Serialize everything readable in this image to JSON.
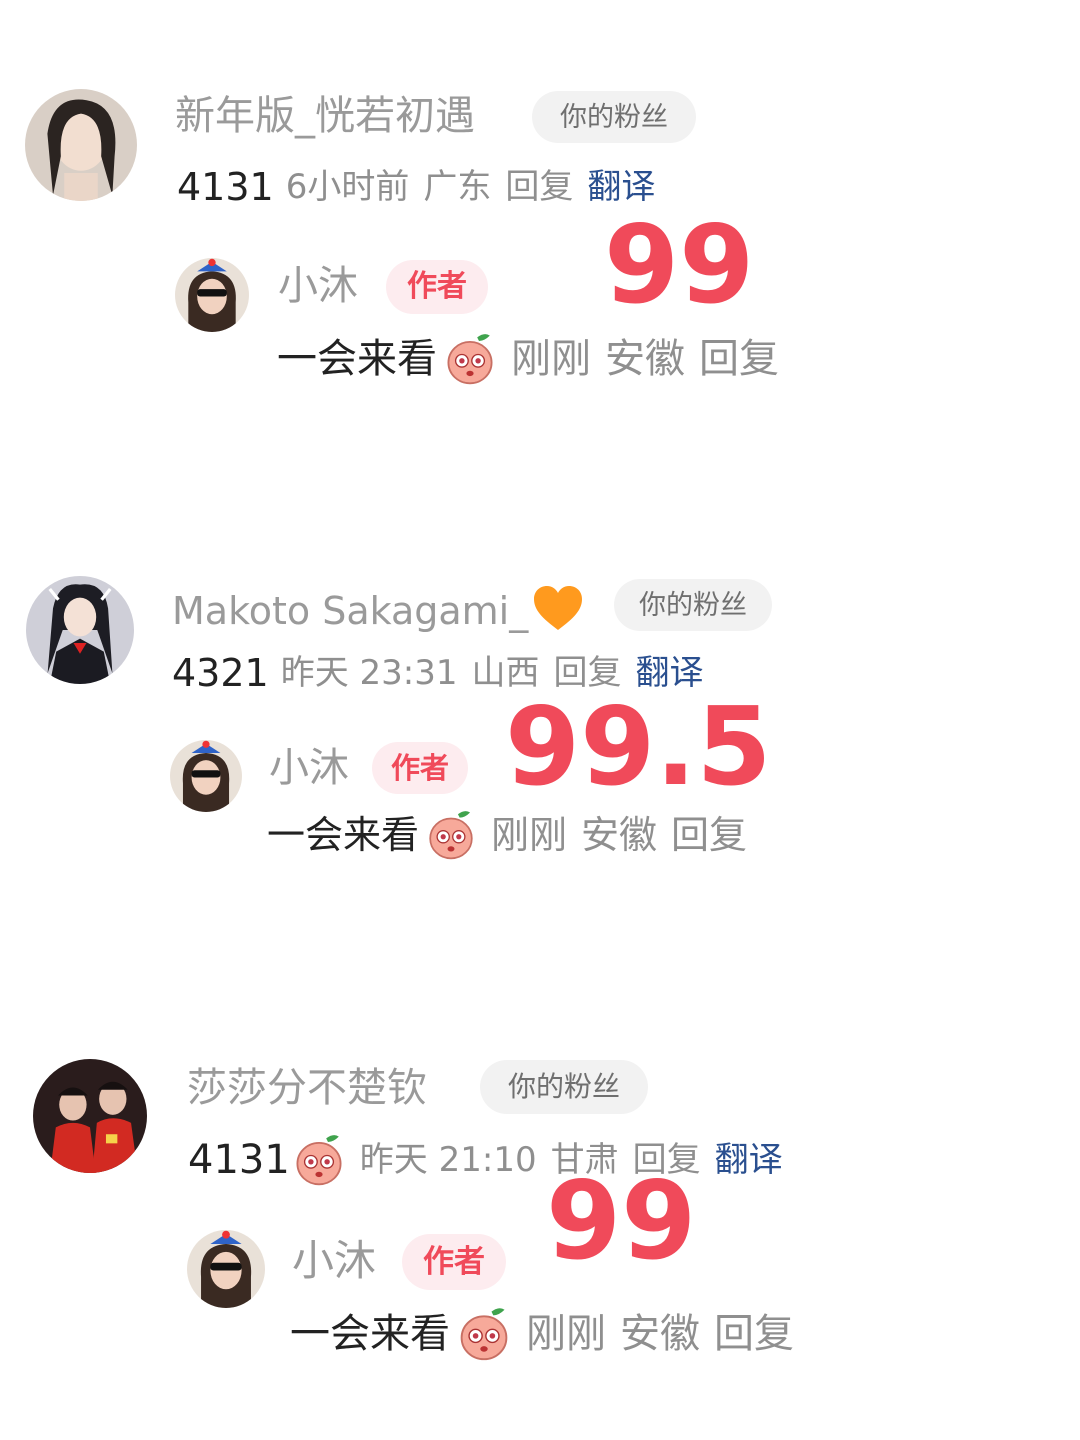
{
  "comments": [
    {
      "username": "新年版_恍若初遇",
      "fan_badge": "你的粉丝",
      "count": "4131",
      "time": "6小时前",
      "location": "广东",
      "reply_label": "回复",
      "translate_label": "翻译",
      "reply": {
        "username": "小沐",
        "author_badge": "作者",
        "text": "一会来看",
        "emoji": "peach-shocked-emoji",
        "time": "刚刚",
        "location": "安徽",
        "reply_label": "回复"
      },
      "score": "99"
    },
    {
      "username": "Makoto Sakagami_",
      "username_icon": "orange-heart-icon",
      "fan_badge": "你的粉丝",
      "count": "4321",
      "time": "昨天 23:31",
      "location": "山西",
      "reply_label": "回复",
      "translate_label": "翻译",
      "reply": {
        "username": "小沐",
        "author_badge": "作者",
        "text": "一会来看",
        "emoji": "peach-shocked-emoji",
        "time": "刚刚",
        "location": "安徽",
        "reply_label": "回复"
      },
      "score": "99.5"
    },
    {
      "username": "莎莎分不楚钦",
      "fan_badge": "你的粉丝",
      "count": "4131",
      "count_emoji": "peach-shocked-emoji",
      "time": "昨天 21:10",
      "location": "甘肃",
      "reply_label": "回复",
      "translate_label": "翻译",
      "reply": {
        "username": "小沐",
        "author_badge": "作者",
        "text": "一会来看",
        "emoji": "peach-shocked-emoji",
        "time": "刚刚",
        "location": "安徽",
        "reply_label": "回复"
      },
      "score": "99"
    }
  ],
  "colors": {
    "accent_red": "#f04a5a",
    "translate_blue": "#2a4f8f",
    "grey_text": "#8f8f8f"
  }
}
